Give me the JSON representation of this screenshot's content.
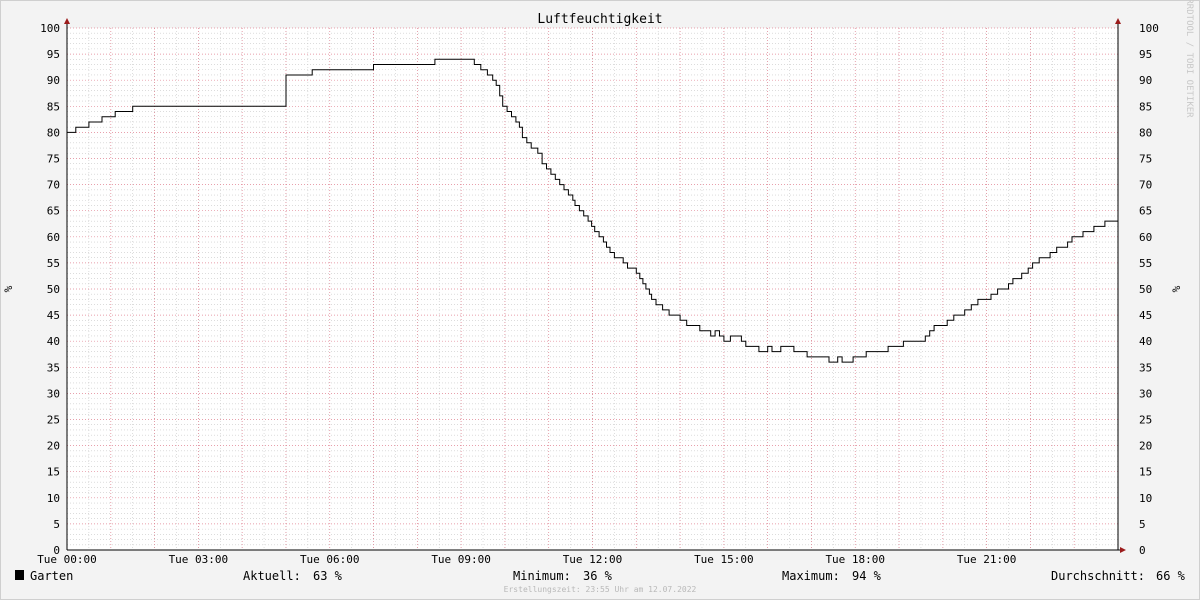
{
  "chart_data": {
    "type": "line",
    "title": "Luftfeuchtigkeit",
    "ylabel": "%",
    "ylim": [
      0,
      100
    ],
    "y_ticks": [
      0,
      5,
      10,
      15,
      20,
      25,
      30,
      35,
      40,
      45,
      50,
      55,
      60,
      65,
      70,
      75,
      80,
      85,
      90,
      95,
      100
    ],
    "xlim_hours": [
      0,
      24
    ],
    "x_ticks": [
      {
        "hour": 0,
        "label": "Tue 00:00"
      },
      {
        "hour": 3,
        "label": "Tue 03:00"
      },
      {
        "hour": 6,
        "label": "Tue 06:00"
      },
      {
        "hour": 9,
        "label": "Tue 09:00"
      },
      {
        "hour": 12,
        "label": "Tue 12:00"
      },
      {
        "hour": 15,
        "label": "Tue 15:00"
      },
      {
        "hour": 18,
        "label": "Tue 18:00"
      },
      {
        "hour": 21,
        "label": "Tue 21:00"
      }
    ],
    "grid": true,
    "legend_placement": "bottom-left",
    "series": [
      {
        "name": "Garten",
        "color": "#000000",
        "points": [
          [
            0.0,
            80
          ],
          [
            0.2,
            81
          ],
          [
            0.5,
            82
          ],
          [
            0.8,
            83
          ],
          [
            1.1,
            84
          ],
          [
            1.5,
            85
          ],
          [
            5.0,
            91
          ],
          [
            5.6,
            92
          ],
          [
            7.0,
            93
          ],
          [
            8.4,
            94
          ],
          [
            9.3,
            93
          ],
          [
            9.45,
            92
          ],
          [
            9.6,
            91
          ],
          [
            9.72,
            90
          ],
          [
            9.8,
            89
          ],
          [
            9.88,
            87
          ],
          [
            9.95,
            85
          ],
          [
            10.05,
            84
          ],
          [
            10.15,
            83
          ],
          [
            10.25,
            82
          ],
          [
            10.33,
            81
          ],
          [
            10.4,
            79
          ],
          [
            10.5,
            78
          ],
          [
            10.6,
            77
          ],
          [
            10.75,
            76
          ],
          [
            10.85,
            74
          ],
          [
            10.95,
            73
          ],
          [
            11.05,
            72
          ],
          [
            11.15,
            71
          ],
          [
            11.25,
            70
          ],
          [
            11.35,
            69
          ],
          [
            11.45,
            68
          ],
          [
            11.55,
            67
          ],
          [
            11.6,
            66
          ],
          [
            11.7,
            65
          ],
          [
            11.8,
            64
          ],
          [
            11.9,
            63
          ],
          [
            11.98,
            62
          ],
          [
            12.05,
            61
          ],
          [
            12.15,
            60
          ],
          [
            12.25,
            59
          ],
          [
            12.32,
            58
          ],
          [
            12.4,
            57
          ],
          [
            12.5,
            56
          ],
          [
            12.7,
            55
          ],
          [
            12.8,
            54
          ],
          [
            13.0,
            53
          ],
          [
            13.08,
            52
          ],
          [
            13.15,
            51
          ],
          [
            13.22,
            50
          ],
          [
            13.3,
            49
          ],
          [
            13.35,
            48
          ],
          [
            13.45,
            47
          ],
          [
            13.6,
            46
          ],
          [
            13.75,
            45
          ],
          [
            14.0,
            44
          ],
          [
            14.15,
            43
          ],
          [
            14.45,
            42
          ],
          [
            14.7,
            41
          ],
          [
            14.8,
            42
          ],
          [
            14.9,
            41
          ],
          [
            15.0,
            40
          ],
          [
            15.15,
            41
          ],
          [
            15.4,
            40
          ],
          [
            15.5,
            39
          ],
          [
            15.8,
            38
          ],
          [
            16.0,
            39
          ],
          [
            16.1,
            38
          ],
          [
            16.3,
            39
          ],
          [
            16.6,
            38
          ],
          [
            16.9,
            37
          ],
          [
            17.4,
            36
          ],
          [
            17.6,
            37
          ],
          [
            17.7,
            36
          ],
          [
            17.95,
            37
          ],
          [
            18.25,
            38
          ],
          [
            18.75,
            39
          ],
          [
            19.1,
            40
          ],
          [
            19.6,
            41
          ],
          [
            19.7,
            42
          ],
          [
            19.8,
            43
          ],
          [
            20.1,
            44
          ],
          [
            20.25,
            45
          ],
          [
            20.5,
            46
          ],
          [
            20.65,
            47
          ],
          [
            20.8,
            48
          ],
          [
            21.1,
            49
          ],
          [
            21.25,
            50
          ],
          [
            21.5,
            51
          ],
          [
            21.6,
            52
          ],
          [
            21.8,
            53
          ],
          [
            21.95,
            54
          ],
          [
            22.05,
            55
          ],
          [
            22.2,
            56
          ],
          [
            22.45,
            57
          ],
          [
            22.6,
            58
          ],
          [
            22.85,
            59
          ],
          [
            22.95,
            60
          ],
          [
            23.2,
            61
          ],
          [
            23.45,
            62
          ],
          [
            23.7,
            63
          ],
          [
            24.0,
            63
          ]
        ]
      }
    ]
  },
  "legend": {
    "series_name": "Garten",
    "aktuell_label": "Aktuell:",
    "aktuell_value": "63 %",
    "minimum_label": "Minimum:",
    "minimum_value": "36 %",
    "maximum_label": "Maximum:",
    "maximum_value": "94 %",
    "durchschnitt_label": "Durchschnitt:",
    "durchschnitt_value": "66 %"
  },
  "footer": {
    "created": "Erstellungszeit: 23:55 Uhr am 12.07.2022"
  },
  "watermark": "RRDTOOL / TOBI OETIKER",
  "colors": {
    "background": "#f3f3f3",
    "plot_background": "#ffffff",
    "major_grid": "#e08090",
    "minor_grid": "#c8c8c8",
    "axis_arrow": "#9b1b1b"
  }
}
